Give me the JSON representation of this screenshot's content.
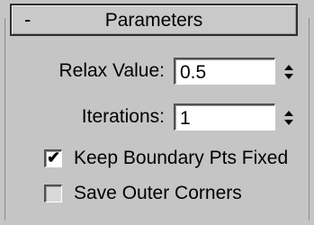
{
  "rollout": {
    "title": "Parameters",
    "collapse_symbol": "-"
  },
  "relax_value": {
    "label": "Relax Value:",
    "value": "0.5"
  },
  "iterations": {
    "label": "Iterations:",
    "value": "1"
  },
  "keep_boundary": {
    "label": "Keep Boundary Pts Fixed",
    "checked": true,
    "check_glyph": "✔"
  },
  "save_outer_corners": {
    "label": "Save Outer Corners",
    "checked": false
  }
}
